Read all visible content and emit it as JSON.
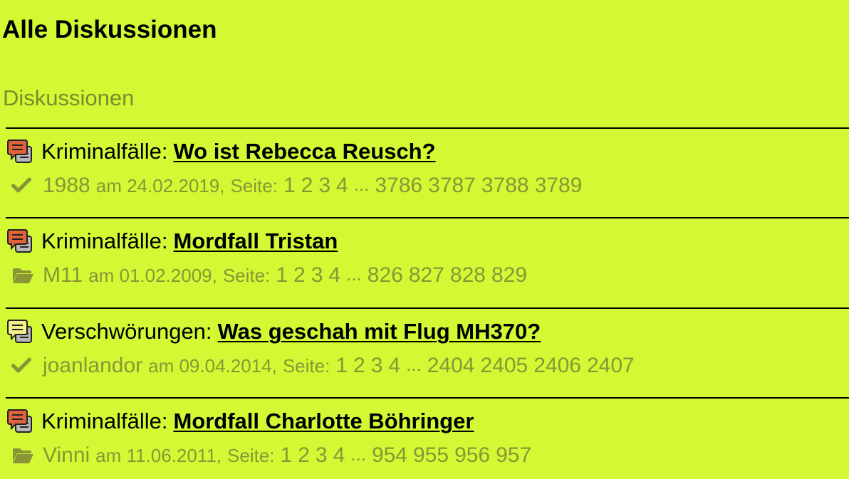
{
  "header": {
    "title": "Alle Diskussionen"
  },
  "section": {
    "title": "Diskussionen"
  },
  "threads": [
    {
      "icon": "speech-bubble-red-icon",
      "category": "Kriminalfälle:",
      "title": "Wo ist Rebecca Reusch?",
      "status_icon": "checkmark-icon",
      "author": "1988",
      "date": "am 24.02.2019,",
      "pages_label": "Seite:",
      "pages": [
        "1",
        "2",
        "3",
        "4",
        "...",
        "3786",
        "3787",
        "3788",
        "3789"
      ]
    },
    {
      "icon": "speech-bubble-red-icon",
      "category": "Kriminalfälle:",
      "title": "Mordfall Tristan",
      "status_icon": "folder-open-icon",
      "author": "M11",
      "date": "am 01.02.2009,",
      "pages_label": "Seite:",
      "pages": [
        "1",
        "2",
        "3",
        "4",
        "...",
        "826",
        "827",
        "828",
        "829"
      ]
    },
    {
      "icon": "speech-bubble-yellow-icon",
      "category": "Verschwörungen:",
      "title": "Was geschah mit Flug MH370?",
      "status_icon": "checkmark-icon",
      "author": "joanlandor",
      "date": "am 09.04.2014,",
      "pages_label": "Seite:",
      "pages": [
        "1",
        "2",
        "3",
        "4",
        "...",
        "2404",
        "2405",
        "2406",
        "2407"
      ]
    },
    {
      "icon": "speech-bubble-red-icon",
      "category": "Kriminalfälle:",
      "title": "Mordfall Charlotte Böhringer",
      "status_icon": "folder-open-icon",
      "author": "Vinni",
      "date": "am 11.06.2011,",
      "pages_label": "Seite:",
      "pages": [
        "1",
        "2",
        "3",
        "4",
        "...",
        "954",
        "955",
        "956",
        "957"
      ]
    }
  ],
  "colors": {
    "background": "#d3f934",
    "muted_text": "#8a9636",
    "bubble_red": "#e0623a",
    "bubble_yellow": "#f4f08a"
  }
}
